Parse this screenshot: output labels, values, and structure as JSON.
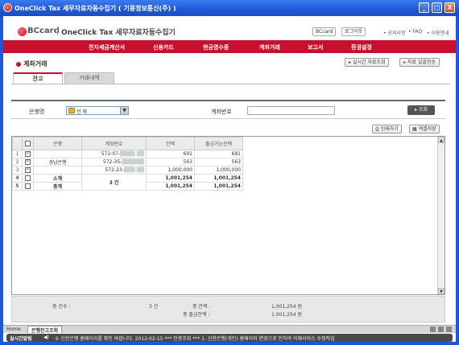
{
  "window": {
    "title": "OneClick Tax 세무자료자동수집기 ( 기웅정보통신(주) )",
    "min": "_",
    "max": "□",
    "close": "X"
  },
  "header": {
    "brand": "BCcard",
    "app_name": "OneClick Tax 세무자료자동수집기",
    "brand_btn": "BCcard",
    "logout_btn": "로그아웃",
    "links": [
      "공지사항",
      "FAQ",
      "이용안내"
    ]
  },
  "nav": {
    "items": [
      "전자세금계산서",
      "신용카드",
      "현금영수증",
      "계좌거래",
      "보고서",
      "환경설정"
    ]
  },
  "page": {
    "title": "계좌거래",
    "realtime_btn": "실시간 자료조회",
    "bulk_btn": "자료 일괄전송"
  },
  "tabs": [
    {
      "label": "잔고",
      "active": true
    },
    {
      "label": "거래내역",
      "active": false
    }
  ],
  "filter": {
    "bank_label": "은행명",
    "bank_value": "전    체",
    "account_label": "계좌번호",
    "account_value": "",
    "query_btn": "조회"
  },
  "actions": {
    "print_btn": "인쇄하기",
    "excel_btn": "엑셀저장"
  },
  "grid": {
    "headers": [
      "",
      "은행",
      "계좌번호",
      "잔액",
      "출금가능잔액"
    ],
    "rows": [
      {
        "num": "1",
        "checked": true,
        "bank": "",
        "account": "572-07-",
        "masked": "▒▒▒▒-▒▒",
        "balance": "691",
        "available": "691"
      },
      {
        "num": "2",
        "checked": true,
        "bank": "경남은행",
        "account": "572-35-",
        "masked": "▒▒▒▒▒▒",
        "balance": "563",
        "available": "563"
      },
      {
        "num": "3",
        "checked": true,
        "bank": "",
        "account": "572-23-",
        "masked": "▒▒▒-▒▒",
        "balance": "1,000,000",
        "available": "1,000,000"
      }
    ],
    "subtotal": {
      "num": "4",
      "label": "소계",
      "count": "3 건",
      "balance": "1,001,254",
      "available": "1,001,254"
    },
    "total": {
      "num": "5",
      "label": "총계",
      "balance": "1,001,254",
      "available": "1,001,254"
    }
  },
  "summary": {
    "count_label": "총 건수 :",
    "count_value": "3 건",
    "balance_label": "총 잔액 :",
    "balance_value": "1,001,254 원",
    "avail_label": "총 출금잔액 :",
    "avail_value": "1,001,254 원"
  },
  "bottom_tabs": {
    "home": "Home",
    "current": "은행잔고조회"
  },
  "ticker": {
    "label": "실시간알림",
    "message": "① 신한은행     홈페이지를 확인 바랍니다.     2012-02-15     *** 인증조회 ***     1. 신한은행(개인)     홈페이지 변경으로 인하여     이체서비스 수정작업"
  },
  "colors": {
    "brand_red": "#c8102e",
    "titlebar_blue": "#1f58d6"
  }
}
